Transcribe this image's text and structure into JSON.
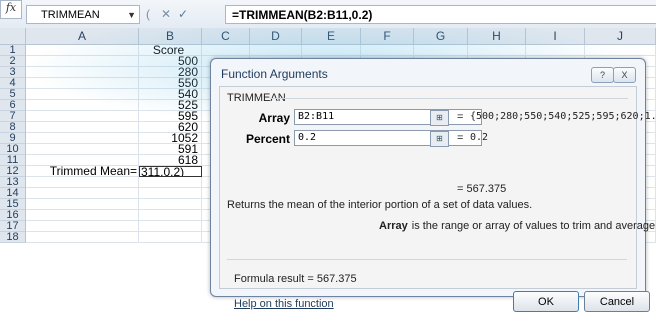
{
  "name_box": "TRIMMEAN",
  "formula_bar": {
    "cancel_icon": "x-icon",
    "enter_icon": "check-icon",
    "fx_label": "fx",
    "formula": "=TRIMMEAN(B2:B11,0.2)"
  },
  "sheet": {
    "columns": [
      "A",
      "B",
      "C",
      "D",
      "E",
      "F",
      "G",
      "H",
      "I",
      "J"
    ],
    "rows": [
      "1",
      "2",
      "3",
      "4",
      "5",
      "6",
      "7",
      "8",
      "9",
      "10",
      "11",
      "12",
      "13",
      "14",
      "15",
      "16",
      "17",
      "18"
    ],
    "col_b_values": [
      "Score",
      "500",
      "280",
      "550",
      "540",
      "525",
      "595",
      "620",
      "1052",
      "591",
      "618"
    ],
    "a12": "Trimmed Mean=",
    "b12": "311,0.2)"
  },
  "dialog": {
    "title": "Function Arguments",
    "help_icon": "?",
    "close_icon": "X",
    "function_name": "TRIMMEAN",
    "args": [
      {
        "label": "Array",
        "value": "B2:B11",
        "result": "{500;280;550;540;525;595;620;1..."
      },
      {
        "label": "Percent",
        "value": "0.2",
        "result": "0.2"
      }
    ],
    "eq": "=",
    "function_result": "= 567.375",
    "description": "Returns the mean of the interior portion of a set of data values.",
    "arg_help_name": "Array",
    "arg_help_text": "is the range or array of values to trim and average.",
    "formula_result": "Formula result =  567.375",
    "help_link": "Help on this function",
    "ok_label": "OK",
    "cancel_label": "Cancel"
  }
}
